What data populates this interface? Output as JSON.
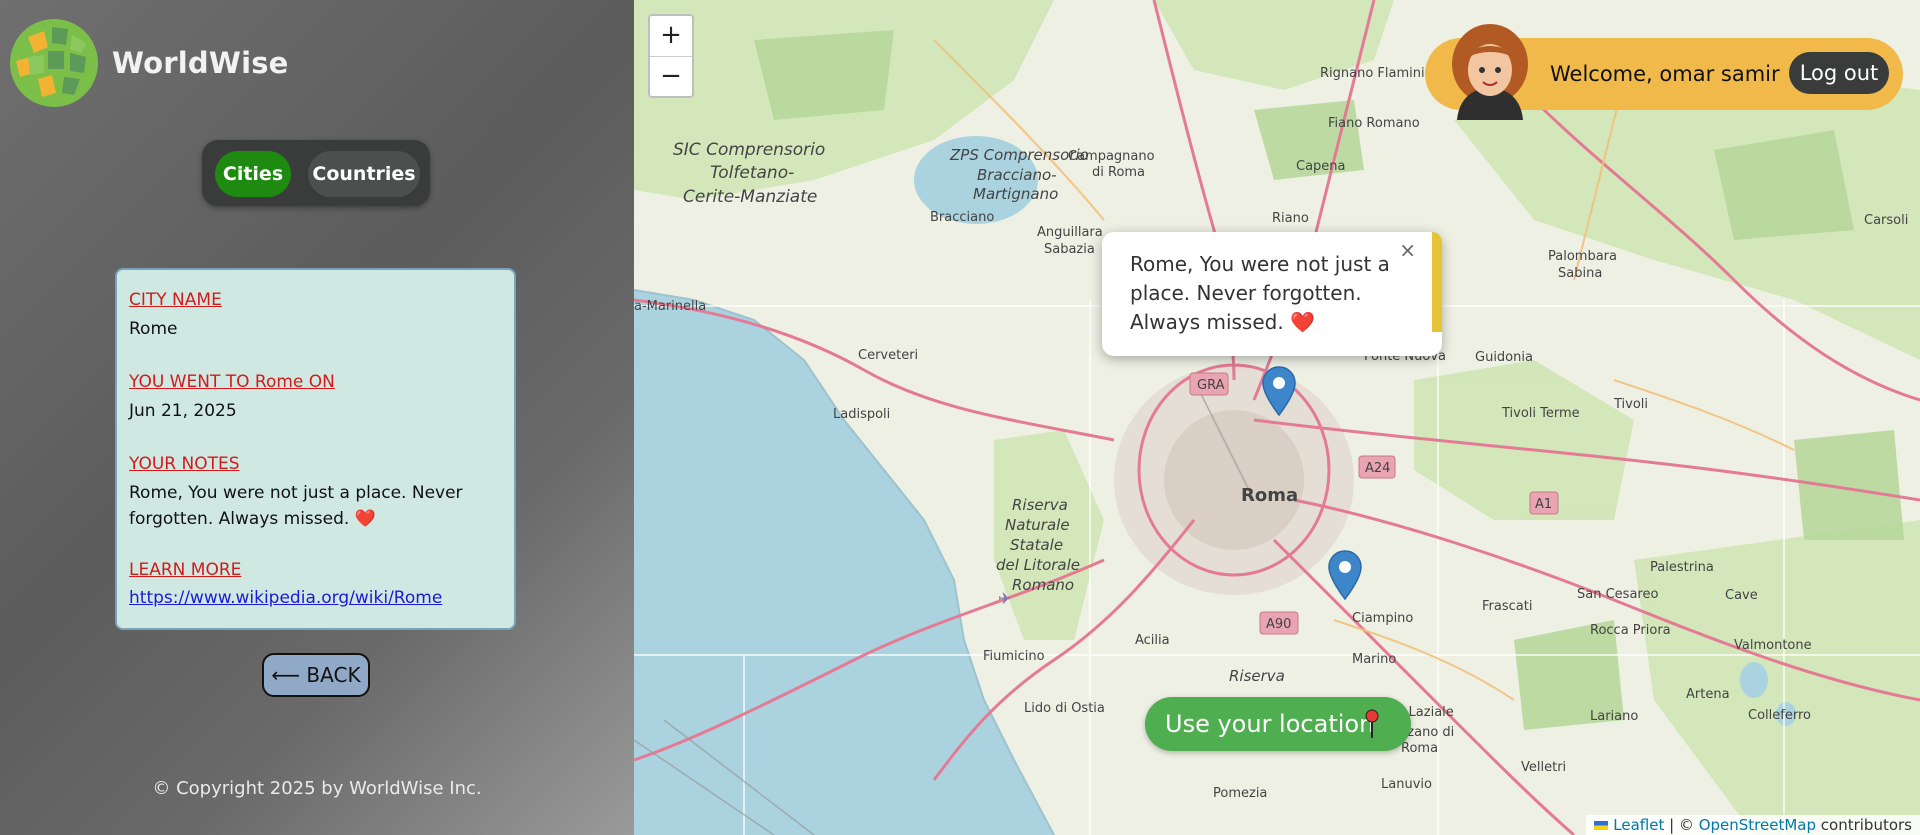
{
  "brand": {
    "name": "WorldWise"
  },
  "tabs": {
    "cities": "Cities",
    "countries": "Countries"
  },
  "city": {
    "name_label": "CITY NAME",
    "name": "Rome",
    "went_label": "YOU WENT TO Rome ON",
    "date": "Jun 21, 2025",
    "notes_label": "YOUR NOTES",
    "notes_line1": "Rome, You were not just a place. Never",
    "notes_line2": "forgotten. Always missed. ❤️",
    "learn_label": "LEARN MORE",
    "link": "https://www.wikipedia.org/wiki/Rome"
  },
  "back_label": "⟵ BACK",
  "copyright": "© Copyright 2025 by WorldWise Inc.",
  "map": {
    "zoom_in": "+",
    "zoom_out": "−",
    "welcome": "Welcome, omar samir",
    "logout": "Log out",
    "popup_line1": "Rome, You were not just a",
    "popup_line2": "place. Never forgotten.",
    "popup_line3": "Always missed. ❤️",
    "popup_close": "×",
    "locate_label": "Use your location",
    "attribution_leaflet": "Leaflet",
    "attribution_sep": " | © ",
    "attribution_osm": "OpenStreetMap",
    "attribution_tail": " contributors",
    "labels": {
      "l1": "SIC Comprensorio",
      "l2": "Tolfetano-",
      "l3": "Cerite-Manziate",
      "l4": "ZPS Comprensorio",
      "l5": "Bracciano-",
      "l6": "Martignano",
      "rignano": "Rignano Flaminio",
      "fiano": "Fiano Romano",
      "campagnano": "Campagnano",
      "diroma": "di Roma",
      "capena": "Capena",
      "bracciano": "Bracciano",
      "anguillara": "Anguillara",
      "sabazia": "Sabazia",
      "riano": "Riano",
      "palombara": "Palombara",
      "sabina": "Sabina",
      "carsoli": "Carsoli",
      "marinella": "a-Marinella",
      "cerveteri": "Cerveteri",
      "fonte": "Fonte Nuova",
      "guidonia": "Guidonia",
      "gra": "GRA",
      "ladispoli": "Ladispoli",
      "tivoli": "Tivoli",
      "tivoliterme": "Tivoli Terme",
      "a24": "A24",
      "a1": "A1",
      "roma": "Roma",
      "riserva1": "Riserva",
      "riserva2": "Naturale",
      "riserva3": "Statale",
      "riserva4": "del Litorale",
      "riserva5": "Romano",
      "palestrina": "Palestrina",
      "frascati": "Frascati",
      "sancesareo": "San Cesareo",
      "cave": "Cave",
      "ciampino": "Ciampino",
      "a90": "A90",
      "acilia": "Acilia",
      "rocca": "Rocca Priora",
      "valmontone": "Valmontone",
      "fiumicino": "Fiumicino",
      "marino": "Marino",
      "riserva6": "Riserva",
      "lido": "Lido di Ostia",
      "laziale": "bano Laziale",
      "genzano": "Genzano di",
      "genzano2": "Roma",
      "lariano": "Lariano",
      "artena": "Artena",
      "colleferro": "Colleferro",
      "velletri": "Velletri",
      "lanuvio": "Lanuvio",
      "pomezia": "Pomezia"
    }
  },
  "colors": {
    "accent_green": "#1f8a10",
    "label_red": "#d11b1b",
    "user_bar": "#f0b94a",
    "locate": "#4fae4f"
  }
}
